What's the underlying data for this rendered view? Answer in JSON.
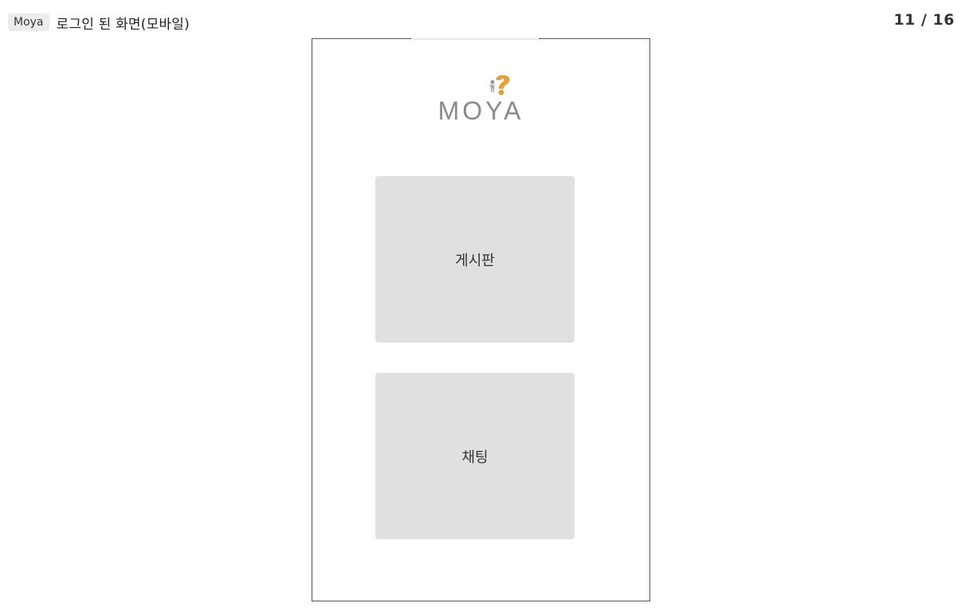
{
  "header": {
    "project_tag": "Moya",
    "title": "로그인 된 화면(모바일)",
    "page_counter": "11 / 16"
  },
  "mobile": {
    "logo": {
      "text": "MOYA",
      "icon": "question-mark-person-icon"
    },
    "tiles": [
      {
        "label": "게시판"
      },
      {
        "label": "채팅"
      }
    ]
  },
  "colors": {
    "tile_background": "#e0e0e0",
    "logo_text": "#8a8a8a",
    "logo_question_mark": "#f0a030",
    "frame_border": "#555555"
  }
}
